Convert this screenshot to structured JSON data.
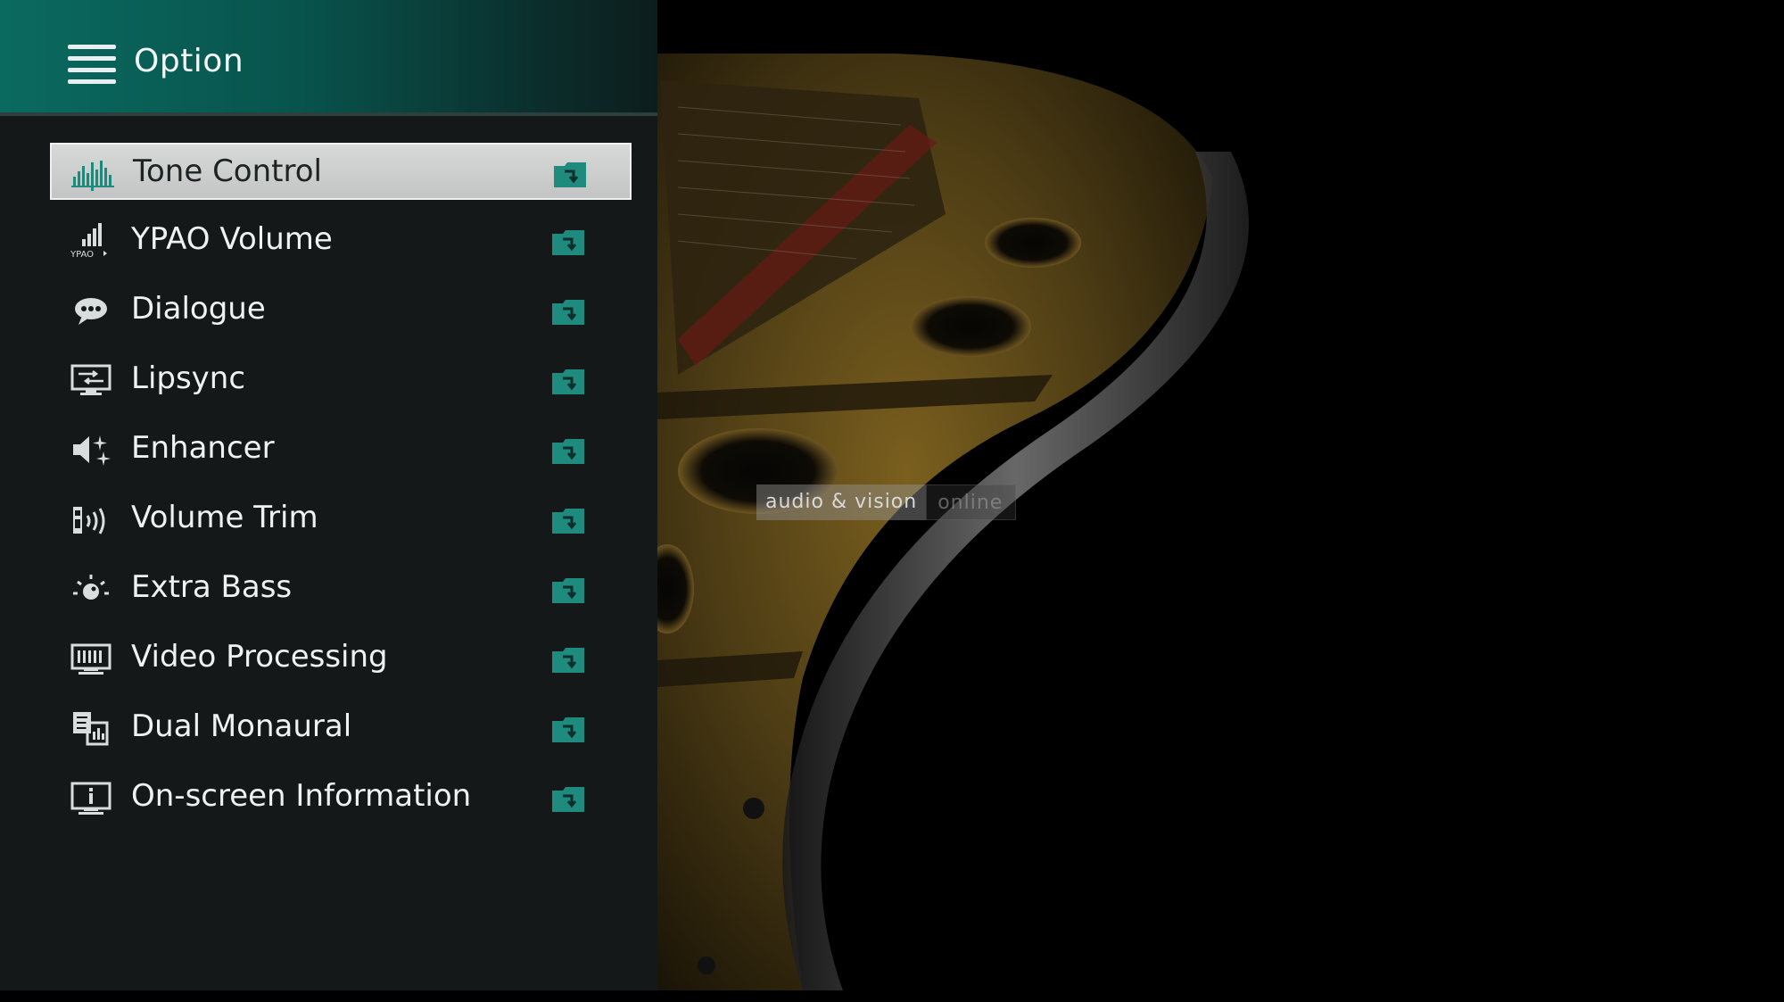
{
  "header": {
    "title": "Option"
  },
  "menu": {
    "selected_index": 0,
    "items": [
      {
        "label": "Tone Control",
        "icon": "equalizer-icon"
      },
      {
        "label": "YPAO Volume",
        "icon": "ypao-volume-icon"
      },
      {
        "label": "Dialogue",
        "icon": "speech-bubble-icon"
      },
      {
        "label": "Lipsync",
        "icon": "lipsync-monitor-icon"
      },
      {
        "label": "Enhancer",
        "icon": "speaker-sparkle-icon"
      },
      {
        "label": "Volume Trim",
        "icon": "volume-waves-icon"
      },
      {
        "label": "Extra Bass",
        "icon": "bass-burst-icon"
      },
      {
        "label": "Video Processing",
        "icon": "video-processing-icon"
      },
      {
        "label": "Dual Monaural",
        "icon": "dual-monaural-icon"
      },
      {
        "label": "On-screen Information",
        "icon": "info-monitor-icon"
      }
    ]
  },
  "watermark": {
    "part1": "audio & vision",
    "part2": "online"
  },
  "colors": {
    "header_accent": "#0a6a60",
    "action_icon": "#1f8a7e",
    "selected_row": "#cfd1d0",
    "panel_bg": "#141818"
  }
}
